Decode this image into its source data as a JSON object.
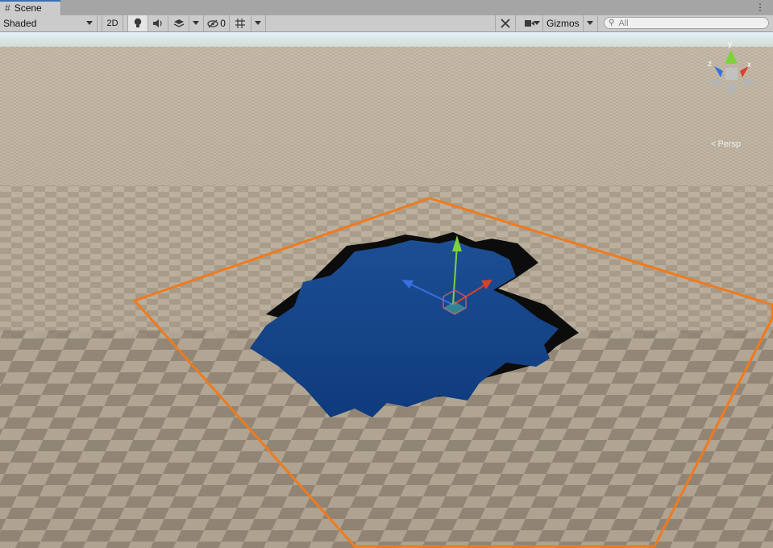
{
  "window": {
    "tab_label": "Scene",
    "tab_icon": "grid-icon",
    "menu_icon": "kebab-menu-icon"
  },
  "toolbar": {
    "draw_mode": "Shaded",
    "mode_2d": "2D",
    "visibility_count": "0",
    "gizmos_label": "Gizmos",
    "search_placeholder": "All"
  },
  "scene": {
    "view_mode": "Persp",
    "gizmo_axes": {
      "x": "x",
      "y": "y",
      "z": "z"
    }
  },
  "colors": {
    "toolbar_bg": "#cbcbcb",
    "accent": "#3a72b0",
    "water": "#1b4f99",
    "selection_outline": "#f07a1e",
    "axis_x": "#d9412b",
    "axis_y": "#7ed23a",
    "axis_z": "#3a6fe0"
  }
}
